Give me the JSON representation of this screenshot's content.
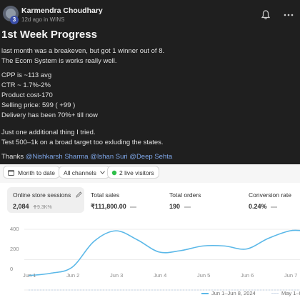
{
  "post": {
    "author": "Karmendra Choudhary",
    "level_badge": "3",
    "time": "12d ago in",
    "channel": "WINS",
    "title": "1st Week Progress",
    "lines": [
      "last month was a breakeven, but got 1 winner out of 8.",
      "The Ecom System is works really well.",
      "CPP is ~113 avg",
      "CTR ~ 1.7%-2%",
      "Product cost-170",
      "Selling price: 599 ( +99 )",
      "Delivery has been 70%+ till now",
      "Just one additional thing I tried.",
      "Test 500–1k on a broad target too exluding the states."
    ],
    "thanks": "Thanks",
    "mentions": [
      "@Nishkarsh Sharma",
      "@Ishan Suri",
      "@Deep Sehta"
    ],
    "icons": [
      "bell-icon",
      "more-icon"
    ]
  },
  "dashboard": {
    "filters": {
      "date_range": "Month to date",
      "channels": "All channels",
      "live_visitors": "2 live visitors"
    },
    "metrics": [
      {
        "label": "Online store sessions",
        "value": "2,084",
        "delta": "9.3K%",
        "selected": true
      },
      {
        "label": "Total sales",
        "value": "₹111,800.00",
        "delta": ""
      },
      {
        "label": "Total orders",
        "value": "190",
        "delta": ""
      },
      {
        "label": "Conversion rate",
        "value": "0.24%",
        "delta": ""
      }
    ],
    "legend": {
      "current": "Jun 1–Jun 8, 2024",
      "previous": "May 1–8"
    },
    "colors": {
      "current": "#5bb8e8",
      "previous": "#c9d6e6",
      "live_dot": "#2fbf4a"
    }
  },
  "chart_data": {
    "type": "line",
    "x": [
      "Jun 1",
      "Jun 2",
      "Jun 3",
      "Jun 4",
      "Jun 5",
      "Jun 6",
      "Jun 7"
    ],
    "ytick_labels": [
      "400",
      "200",
      "0"
    ],
    "ylim": [
      0,
      400
    ],
    "grid": true,
    "series": [
      {
        "name": "Jun 1–Jun 8, 2024",
        "points": [
          [
            0,
            95
          ],
          [
            0.5,
            110
          ],
          [
            1,
            150
          ],
          [
            1.5,
            320
          ],
          [
            2,
            390
          ],
          [
            2.5,
            330
          ],
          [
            3,
            250
          ],
          [
            3.5,
            260
          ],
          [
            4,
            290
          ],
          [
            4.5,
            290
          ],
          [
            5,
            270
          ],
          [
            5.5,
            340
          ],
          [
            6,
            390
          ],
          [
            6.3,
            390
          ]
        ]
      },
      {
        "name": "May 1–8",
        "points": [
          [
            0,
            0
          ],
          [
            6.3,
            0
          ]
        ]
      }
    ]
  }
}
